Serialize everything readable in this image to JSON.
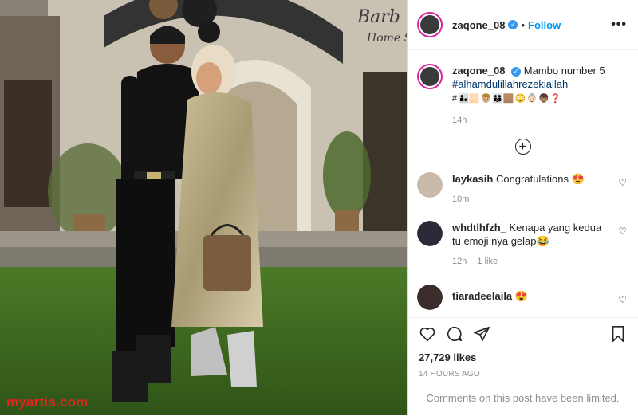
{
  "post": {
    "username": "zaqone_08",
    "follow_label": "Follow",
    "more_label": "•••",
    "caption_line1": "Mambo number 5",
    "caption_line2": "#alhamdulillahrezekiallah",
    "caption_line3": "#👨‍👦🏻👦🏼👨‍👩‍👦🏽😳👵🏻👦🏽❓",
    "caption_time": "14h",
    "likes": "27,729 likes",
    "posted_ago": "14 HOURS AGO",
    "limited_notice": "Comments on this post have been limited."
  },
  "comments": [
    {
      "username": "laykasih",
      "text": "Congratulations 😍",
      "time": "10m",
      "likes": ""
    },
    {
      "username": "whdtlhfzh_",
      "text": "Kenapa yang kedua tu emoji nya gelap😂",
      "time": "12h",
      "likes": "1 like"
    },
    {
      "username": "tiaradeelaila",
      "text": "😍",
      "time": "",
      "likes": ""
    }
  ],
  "photo": {
    "sign_text": "Barbe... Home S...",
    "watermark": "myartis.com"
  },
  "colors": {
    "accent": "#0095f6",
    "verified": "#3897f0",
    "watermark": "#e8201e"
  }
}
